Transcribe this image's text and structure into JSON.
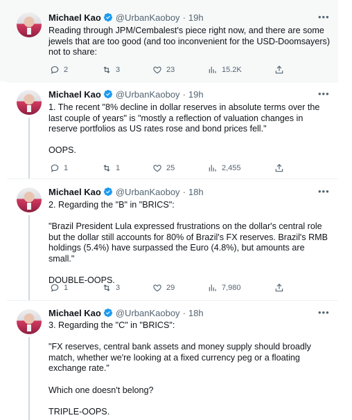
{
  "tweets": [
    {
      "name": "Michael Kao",
      "handle": "@UrbanKaoboy",
      "time": "19h",
      "text": "Reading through JPM/Cembalest's piece right now, and there are some jewels that are too good (and too inconvenient for the USD-Doomsayers) not to share:",
      "replies": "2",
      "retweets": "3",
      "likes": "23",
      "views": "15.2K"
    },
    {
      "name": "Michael Kao",
      "handle": "@UrbanKaoboy",
      "time": "19h",
      "text": "1. The recent \"8% decline in dollar reserves in absolute terms over the last couple of years\" is \"mostly a reflection of valuation changes in reserve portfolios as US rates rose and bond prices fell.\"\n\nOOPS.",
      "replies": "1",
      "retweets": "1",
      "likes": "25",
      "views": "2,455"
    },
    {
      "name": "Michael Kao",
      "handle": "@UrbanKaoboy",
      "time": "18h",
      "text": "2. Regarding the \"B\" in \"BRICS\":\n\n\"Brazil President Lula expressed frustrations on the dollar's central role but the dollar still accounts for 80% of Brazil's FX reserves. Brazil's RMB holdings (5.4%) have surpassed the Euro (4.8%), but amounts are small.\"\n\nDOUBLE-OOPS.",
      "replies": "1",
      "retweets": "3",
      "likes": "29",
      "views": "7,980"
    },
    {
      "name": "Michael Kao",
      "handle": "@UrbanKaoboy",
      "time": "18h",
      "text": "3. Regarding the \"C\" in \"BRICS\":\n\n\"FX reserves, central bank assets and money supply should broadly match, whether we're looking at a fixed currency peg or a floating exchange rate.\"\n\nWhich one doesn't belong?\n\nTRIPLE-OOPS.",
      "replies": "",
      "retweets": "",
      "likes": "",
      "views": ""
    }
  ],
  "separator": "·",
  "more_glyph": "•••",
  "colors": {
    "verified": "#1d9bf0",
    "muted": "#536471",
    "highlight_bg": "#f7f9f9"
  },
  "icons": [
    "verified-badge-icon",
    "reply-icon",
    "retweet-icon",
    "like-icon",
    "views-icon",
    "share-icon",
    "more-icon"
  ]
}
